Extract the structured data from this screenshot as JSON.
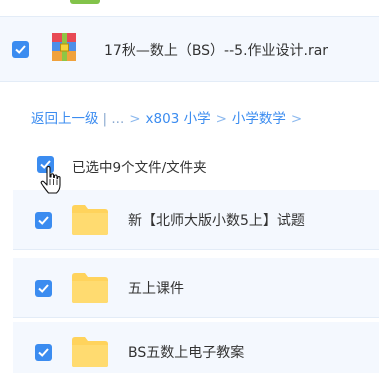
{
  "file_row": {
    "name": "17秋—数上（BS）--5.作业设计.rar",
    "checked": true,
    "icon": "rar-archive-icon"
  },
  "breadcrumb": {
    "back": "返回上一级",
    "divider": "|",
    "ellipsis": "...",
    "sep": ">",
    "items": [
      "x803 小学",
      "小学数学"
    ],
    "trailing_sep": ">"
  },
  "selection": {
    "summary": "已选中9个文件/文件夹",
    "checked": true
  },
  "folders": [
    {
      "name": "新【北师大版小数5上】试题",
      "checked": true
    },
    {
      "name": "五上课件",
      "checked": true
    },
    {
      "name": "BS五数上电子教案",
      "checked": true
    }
  ],
  "colors": {
    "accent": "#3b8cf0",
    "row_bg": "#f4f8fe",
    "folder": "#ffd35c"
  }
}
